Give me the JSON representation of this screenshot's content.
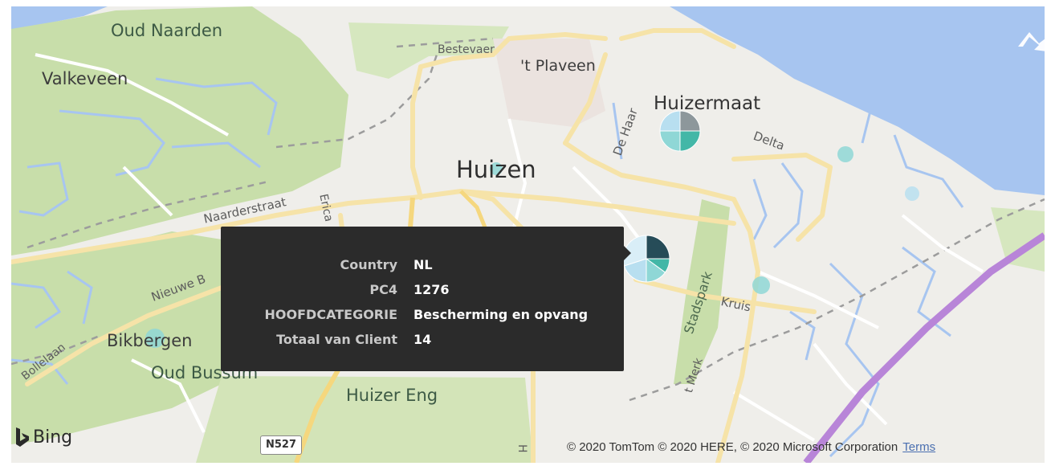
{
  "map": {
    "provider": "Bing",
    "attribution": "© 2020 TomTom © 2020 HERE, © 2020 Microsoft Corporation",
    "terms_link": "Terms",
    "road_shield": "N527",
    "places": {
      "oud_naarden": "Oud Naarden",
      "valkeveen": "Valkeveen",
      "bestevaer": "Bestevaer",
      "t_plaveen": "'t Plaveen",
      "huizermaat": "Huizermaat",
      "de_haar": "De Haar",
      "delta": "Delta",
      "huizen": "Huizen",
      "naarderstraat": "Naarderstraat",
      "erica": "Erica",
      "nieuwe_bussumerweg": "Nieuwe B",
      "bikbergen": "Bikbergen",
      "oud_bussum": "Oud Bussum",
      "bollelaan": "Bollelaan",
      "huizer_eng": "Huizer Eng",
      "stadspark": "Stadspark",
      "kruis": "Kruis",
      "t_merk": "t Merk",
      "h_road": "H"
    },
    "colors": {
      "water": "#a7c5f0",
      "land": "#efeeea",
      "forest": "#c8deaa",
      "road": "#f6e3a8",
      "road_major": "#f5d77e",
      "highway": "#b885d8",
      "pie_dark": "#264c58",
      "pie_mid": "#43b7a7",
      "pie_light": "#8fd7d6",
      "pie_pale": "#b8dff0",
      "pie_grey": "#8d979b"
    }
  },
  "tooltip": {
    "rows": [
      {
        "key": "Country",
        "value": "NL"
      },
      {
        "key": "PC4",
        "value": "1276"
      },
      {
        "key": "HOOFDCATEGORIE",
        "value": "Bescherming en opvang"
      },
      {
        "key": "Totaal van Client",
        "value": "14"
      }
    ]
  },
  "markers": [
    {
      "name": "Huizermaat",
      "slices": [
        0.25,
        0.25,
        0.25,
        0.25
      ]
    },
    {
      "name": "1276",
      "slices": [
        0.25,
        0.1,
        0.15,
        0.2,
        0.3
      ]
    },
    {
      "name": "Huizen",
      "slices": [
        1
      ]
    },
    {
      "name": "Bikbergen",
      "slices": [
        1
      ]
    },
    {
      "name": "Kruis",
      "slices": [
        1
      ]
    },
    {
      "name": "Delta-east",
      "slices": [
        1
      ]
    },
    {
      "name": "east-pale",
      "slices": [
        1
      ]
    }
  ]
}
